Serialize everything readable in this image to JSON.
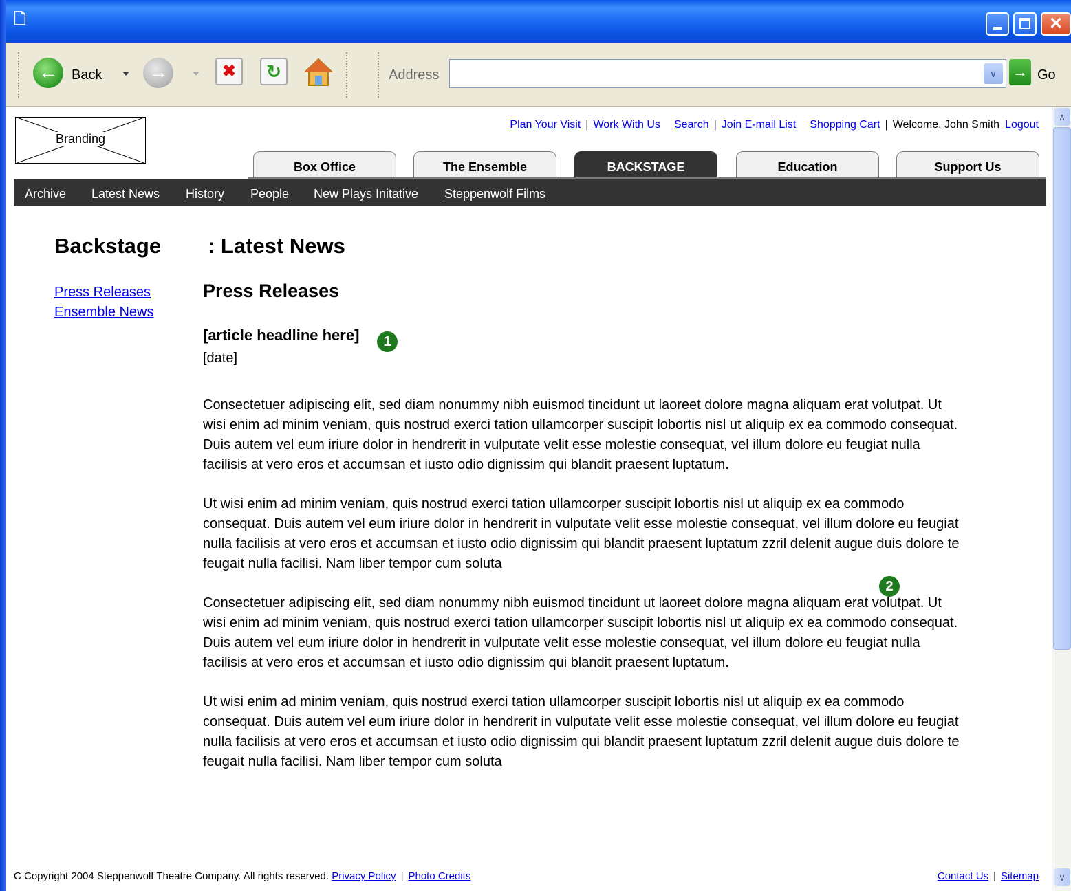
{
  "browser": {
    "back_label": "Back",
    "address_label": "Address",
    "address_value": "",
    "go_label": "Go",
    "icons": [
      "ie-icon",
      "back-arrow-icon",
      "forward-arrow-icon",
      "stop-icon",
      "refresh-icon",
      "home-icon",
      "go-arrow-icon"
    ]
  },
  "header": {
    "branding_label": "Branding",
    "utility_links": [
      "Plan Your Visit",
      "Work With Us",
      "Search",
      "Join E-mail List",
      "Shopping Cart"
    ],
    "welcome_text": "Welcome, John Smith",
    "logout_label": "Logout"
  },
  "tabs": [
    {
      "label": "Box Office"
    },
    {
      "label": "The Ensemble"
    },
    {
      "label": "BACKSTAGE",
      "active": true
    },
    {
      "label": "Education"
    },
    {
      "label": "Support Us"
    }
  ],
  "subnav": [
    "Archive",
    "Latest News",
    "History",
    "People",
    "New Plays Initative",
    "Steppenwolf Films"
  ],
  "main": {
    "section_title": "Backstage",
    "page_title": ": Latest News",
    "left_nav": [
      "Press Releases",
      "Ensemble News"
    ],
    "subtitle": "Press Releases",
    "headline": "[article headline here]",
    "date": "[date]",
    "callouts": [
      "1",
      "2"
    ],
    "paragraphs": [
      "Consectetuer adipiscing elit, sed diam nonummy nibh euismod tincidunt ut laoreet dolore magna aliquam erat volutpat. Ut wisi enim ad minim veniam, quis nostrud exerci tation ullamcorper suscipit lobortis nisl ut aliquip ex ea commodo consequat. Duis autem vel eum iriure dolor in hendrerit in vulputate velit esse molestie consequat, vel illum dolore eu feugiat nulla facilisis at vero eros et accumsan et iusto odio dignissim qui blandit praesent luptatum.",
      "Ut wisi enim ad minim veniam, quis nostrud exerci tation ullamcorper suscipit lobortis nisl ut aliquip ex ea commodo consequat. Duis autem vel eum iriure dolor in hendrerit in vulputate velit esse molestie consequat, vel illum dolore eu feugiat nulla facilisis at vero eros et accumsan et iusto odio dignissim qui blandit praesent luptatum zzril delenit augue duis dolore te feugait nulla facilisi. Nam liber tempor cum soluta",
      "Consectetuer adipiscing elit, sed diam nonummy nibh euismod tincidunt ut laoreet dolore magna aliquam erat volutpat. Ut wisi enim ad minim veniam, quis nostrud exerci tation ullamcorper suscipit lobortis nisl ut aliquip ex ea commodo consequat. Duis autem vel eum iriure dolor in hendrerit in vulputate velit esse molestie consequat, vel illum dolore eu feugiat nulla facilisis at vero eros et accumsan et iusto odio dignissim qui blandit praesent luptatum.",
      "Ut wisi enim ad minim veniam, quis nostrud exerci tation ullamcorper suscipit lobortis nisl ut aliquip ex ea commodo consequat. Duis autem vel eum iriure dolor in hendrerit in vulputate velit esse molestie consequat, vel illum dolore eu feugiat nulla facilisis at vero eros et accumsan et iusto odio dignissim qui blandit praesent luptatum zzril delenit augue duis dolore te feugait nulla facilisi. Nam liber tempor cum soluta"
    ]
  },
  "footer": {
    "copyright": "C Copyright 2004 Steppenwolf Theatre Company. All rights reserved.",
    "privacy_label": "Privacy Policy",
    "photo_credits_label": "Photo Credits",
    "contact_label": "Contact Us",
    "sitemap_label": "Sitemap"
  },
  "colors": {
    "titlebar": "#0a56ea",
    "toolbar_bg": "#ece9d8",
    "nav_dark": "#333333",
    "link": "#0000ee",
    "callout": "#1f7a1f"
  }
}
